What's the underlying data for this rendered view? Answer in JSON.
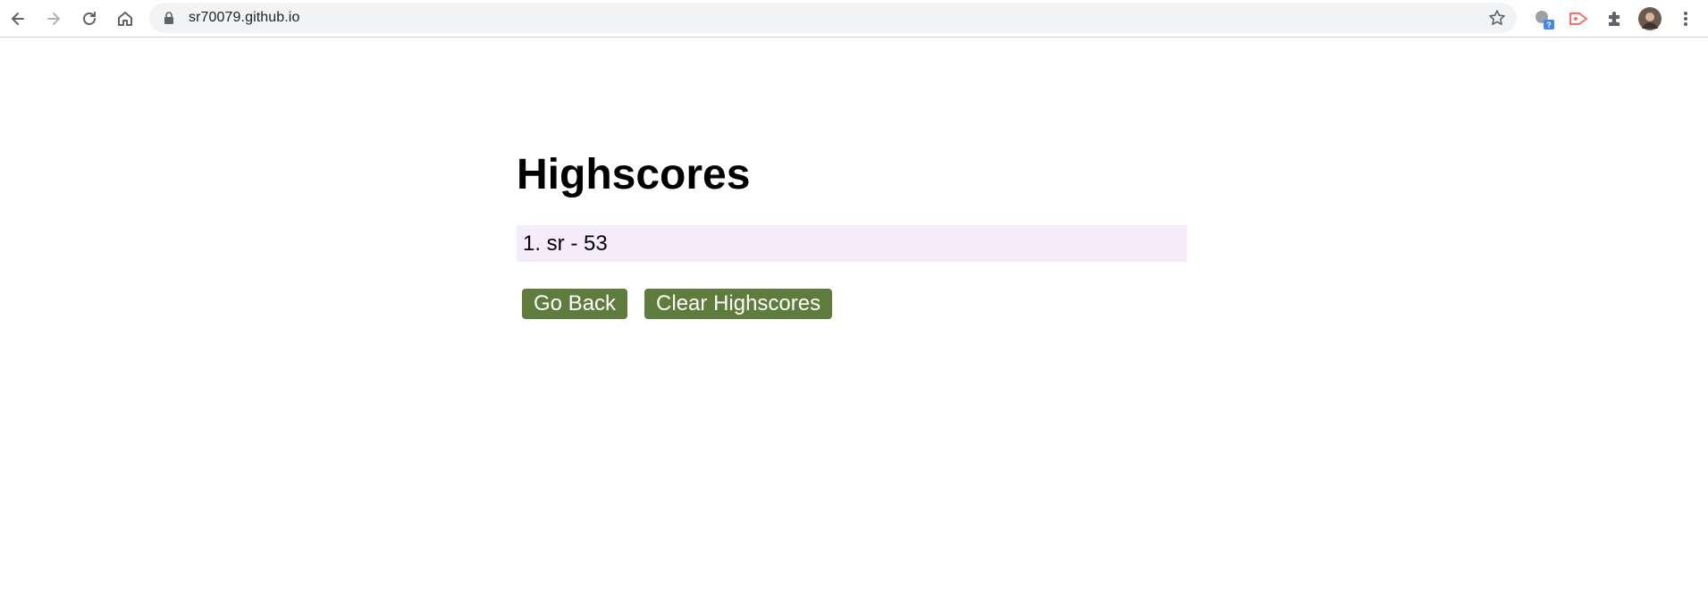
{
  "browser": {
    "url": "sr70079.github.io",
    "extension_badge": "?"
  },
  "page": {
    "title": "Highscores",
    "scores": [
      {
        "text": "1. sr - 53"
      }
    ],
    "buttons": {
      "go_back": "Go Back",
      "clear": "Clear Highscores"
    }
  },
  "colors": {
    "button_bg": "#5e7c3b",
    "score_bg": "#f4ecfb"
  },
  "icons": [
    "back-arrow-icon",
    "forward-arrow-icon",
    "reload-icon",
    "home-icon",
    "lock-icon",
    "star-icon",
    "extension-icon",
    "video-icon",
    "puzzle-icon",
    "avatar",
    "menu-icon"
  ]
}
